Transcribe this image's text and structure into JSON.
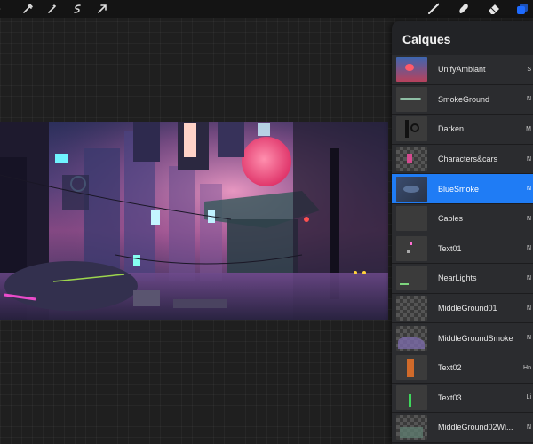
{
  "toolbar": {
    "left_tools": [
      {
        "name": "actions-icon",
        "glyph": "…"
      },
      {
        "name": "adjustments-icon"
      },
      {
        "name": "selection-icon"
      },
      {
        "name": "transform-icon"
      },
      {
        "name": "arrow-icon"
      }
    ],
    "right_tools": [
      "brush-icon",
      "smudge-icon",
      "eraser-icon",
      "layers-icon"
    ],
    "accent_color": "#1e6bff"
  },
  "layers_panel": {
    "title": "Calques",
    "selected_color": "#1f7cf5",
    "layers": [
      {
        "name": "UnifyAmbiant",
        "blend": "S",
        "thumb": "unify"
      },
      {
        "name": "SmokeGround",
        "blend": "N",
        "thumb": "smoke"
      },
      {
        "name": "Darken",
        "blend": "M",
        "thumb": "darken"
      },
      {
        "name": "Characters&cars",
        "blend": "N",
        "thumb": "chars"
      },
      {
        "name": "BlueSmoke",
        "blend": "N",
        "thumb": "bluesmoke",
        "selected": true
      },
      {
        "name": "Cables",
        "blend": "N",
        "thumb": "plain"
      },
      {
        "name": "Text01",
        "blend": "N",
        "thumb": "text01"
      },
      {
        "name": "NearLights",
        "blend": "N",
        "thumb": "near"
      },
      {
        "name": "MiddleGround01",
        "blend": "N",
        "thumb": "checker"
      },
      {
        "name": "MiddleGroundSmoke",
        "blend": "N",
        "thumb": "mgsmoke"
      },
      {
        "name": "Text02",
        "blend": "Hn",
        "thumb": "text02"
      },
      {
        "name": "Text03",
        "blend": "Li",
        "thumb": "text03"
      },
      {
        "name": "MiddleGround02Wi...",
        "blend": "N",
        "thumb": "mg02"
      }
    ]
  }
}
